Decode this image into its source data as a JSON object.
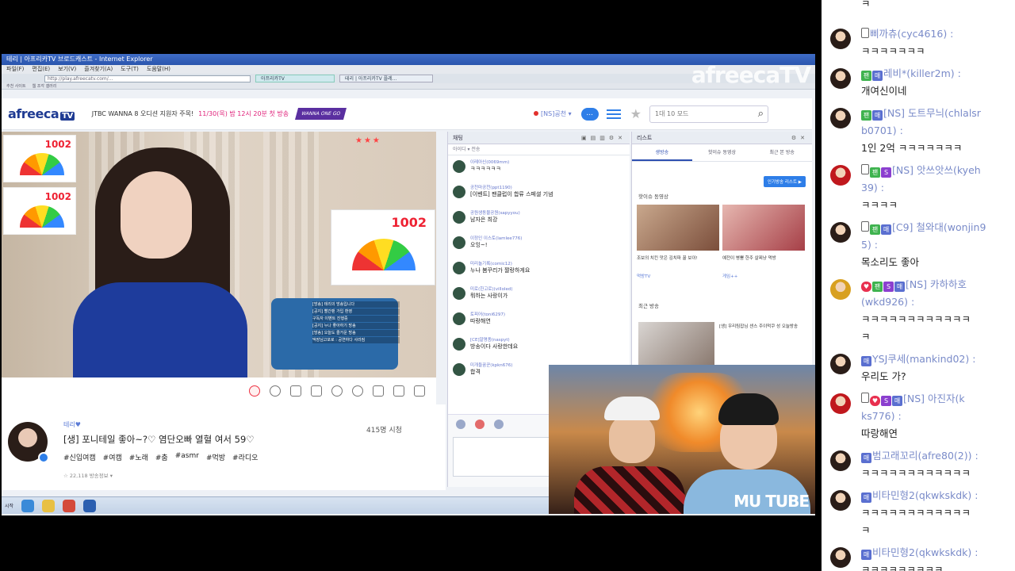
{
  "browser": {
    "window_title": "테리 | 아프리카TV 브로드캐스트 - Internet Explorer",
    "address": "http://play.afreecatv.com/...",
    "tabs": [
      "아프리카TV",
      "테리 | 아프리카TV 플레..."
    ],
    "menu": [
      "파일(F)",
      "편집(E)",
      "보기(V)",
      "즐겨찾기(A)",
      "도구(T)",
      "도움말(H)"
    ],
    "favorites": [
      "추천 사이트",
      "웹 조각 갤러리"
    ],
    "watermark": "afreecaTV"
  },
  "site": {
    "logo": "afreeca",
    "logo_tv": "TV",
    "promo_text": "JTBC WANNA 8 오디션 지원자 주목!",
    "promo_time": "11/30(목) 밤 12시 20분 첫 방송",
    "promo_badge": "WANNA ONE GO",
    "login": "[NS]공천 ▾",
    "chat_icon": "...",
    "search_placeholder": "1대 10 모드"
  },
  "player": {
    "tile_number": "1002",
    "poster_number": "1002",
    "overlay_lines": [
      "[방송] 테리의 방송입니다",
      "[공지] 빨간팬 가입 환영",
      "구독자 이벤트 진행중",
      "[공지] 누나 좋아하기 방송",
      "[방송] 오늘도 즐거운 방송",
      "댁장님고포로 : 공연하다 사라짐"
    ],
    "rating": "★★★"
  },
  "broadcast": {
    "channel": "테리♥",
    "title": "[생] 포니테일 좋아~?♡ 염단오빠 열혈 여서 59♡",
    "tags": [
      "#신입여캠",
      "#여캠",
      "#노래",
      "#춤",
      "#asmr",
      "#먹방",
      "#라디오"
    ],
    "viewers": "415명 시청",
    "sub_info": "☆ 22,118    방송정보 ▾"
  },
  "chat_panel": {
    "title": "채팅",
    "toolbar": "아이디   ▾         전송",
    "messages": [
      {
        "user": "이레아신(0069mm)",
        "text": "ㅋㅋㅋㅋㅋㅋ"
      },
      {
        "user": "공천마공천(ppt1190)",
        "text": "[이벤트] 팬클럽이 합류 스페셜 기념"
      },
      {
        "user": "공원생동물공원(sapyyou)",
        "text": "남자은 최강"
      },
      {
        "user": "이정인 이스토(lamlee776)",
        "text": "오잉~!"
      },
      {
        "user": "미리놀기록(comic12)",
        "text": "누나 봄꾸리가 짤랑하게요"
      },
      {
        "user": "미로(한고로)(villoled)",
        "text": "뭐하는 사랑이가"
      },
      {
        "user": "토피어(toni6297)",
        "text": "따랑해연"
      },
      {
        "user": "[CE]알명종(naspyt)",
        "text": "방송이다 사랑한데요"
      },
      {
        "user": "미개들꿈꾼(kpkn676)",
        "text": "합격"
      }
    ]
  },
  "list_panel": {
    "title": "리스트",
    "tabs": [
      "생방송",
      "핫이슈 동영상",
      "최근 본 방송"
    ],
    "hot_button": "인기방송 리스트 ▶",
    "section1": "핫이슈 동영상",
    "captions": [
      "조보의 치킨 맛은 김치파 꿀 보이!",
      "예전이 병뿜 한주 살찌냥 먹방"
    ],
    "sources": [
      "먹방TV",
      "게임++"
    ],
    "section2": "최근 방송",
    "caption3": "[생] 우리팀잡님 센스 주이먹쿠 성 오늘방송"
  },
  "webcam": {
    "brand": "MU TUBE"
  },
  "taskbar": {
    "start": "시작"
  },
  "right_chat": {
    "top_fragment": "ㅋ",
    "messages": [
      {
        "name": "삐까츄(cyc4616) :",
        "text": "ㅋㅋㅋㅋㅋㅋㅋ",
        "badges": [
          "phone"
        ],
        "avatar": "dark"
      },
      {
        "name": "레비*(killer2m) :",
        "text": "개여신이네",
        "badges": [
          "fan",
          "mgr"
        ],
        "avatar": "dark"
      },
      {
        "name": "[NS] 도트무늬(chlalsr",
        "name2": "b0701) :",
        "text": "1인 2억 ㅋㅋㅋㅋㅋㅋㅋ",
        "badges": [
          "fan",
          "mgr"
        ],
        "avatar": "dark"
      },
      {
        "name": "[NS] 앗쓰앗쓰(kyeh",
        "name2": "39) :",
        "text": "ㅋㅋㅋㅋ",
        "badges": [
          "phone",
          "fan",
          "sub"
        ],
        "avatar": "red"
      },
      {
        "name": "[C9] 철와대(wonjin9",
        "name2": "5) :",
        "text": "목소리도 좋아",
        "badges": [
          "phone",
          "fan",
          "mgr"
        ],
        "avatar": "dark"
      },
      {
        "name": "[NS] 카하하호",
        "name2": "(wkd926) :",
        "text": "ㅋㅋㅋㅋㅋㅋㅋㅋㅋㅋㅋㅋ",
        "text2": "ㅋ",
        "badges": [
          "heart",
          "fan",
          "sub",
          "mgr"
        ],
        "avatar": "gold"
      },
      {
        "name": "YSJ쿠세(mankind02) :",
        "text": "우리도 가?",
        "badges": [
          "mgr"
        ],
        "avatar": "dark"
      },
      {
        "name": "[NS] 아진자(k",
        "name2": "ks776) :",
        "text": "따랑해연",
        "badges": [
          "phone",
          "heart",
          "sub",
          "mgr"
        ],
        "avatar": "red"
      },
      {
        "name": "범고래꼬리(afre80(2)) :",
        "text": "ㅋㅋㅋㅋㅋㅋㅋㅋㅋㅋㅋㅋ",
        "badges": [
          "mgr"
        ],
        "avatar": "dark"
      },
      {
        "name": "비타민형2(qkwkskdk) :",
        "text": "ㅋㅋㅋㅋㅋㅋㅋㅋㅋㅋㅋㅋ",
        "text2": "ㅋ",
        "badges": [
          "mgr"
        ],
        "avatar": "dark"
      },
      {
        "name": "비타민형2(qkwkskdk) :",
        "text": "ㅋㅋㅋㅋㅋㅋㅋㅋㅋ",
        "badges": [
          "mgr"
        ],
        "avatar": "dark"
      }
    ]
  },
  "colors": {
    "afreeca_blue": "#1f3b93",
    "accent_blue": "#2e7ee8",
    "chat_name": "#7a8bc9"
  }
}
